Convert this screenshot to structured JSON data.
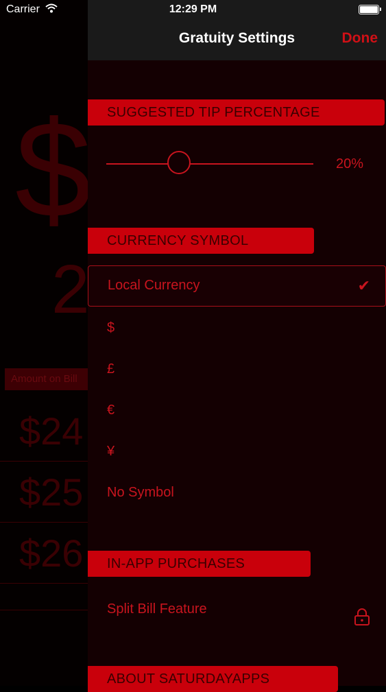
{
  "status_bar": {
    "carrier": "Carrier",
    "time": "12:29 PM"
  },
  "background": {
    "big_symbol": "$",
    "big_number": "2",
    "amount_label": "Amount on Bill",
    "rows": [
      "$24",
      "$25",
      "$26"
    ]
  },
  "navbar": {
    "title": "Gratuity Settings",
    "done": "Done"
  },
  "tip": {
    "header": "SUGGESTED TIP PERCENTAGE",
    "value": "20%",
    "slider_level": 0.35
  },
  "currency": {
    "header": "CURRENCY SYMBOL",
    "options": [
      "Local Currency",
      "$",
      "£",
      "€",
      "¥",
      "No Symbol"
    ],
    "selected": "Local Currency",
    "check": "✔"
  },
  "purchases": {
    "header": "IN-APP PURCHASES",
    "split_bill": "Split Bill Feature"
  },
  "about": {
    "header": "ABOUT SATURDAYAPPS"
  },
  "colors": {
    "accent": "#c9000b",
    "text": "#c8141e",
    "panel_bg": "#140002"
  }
}
